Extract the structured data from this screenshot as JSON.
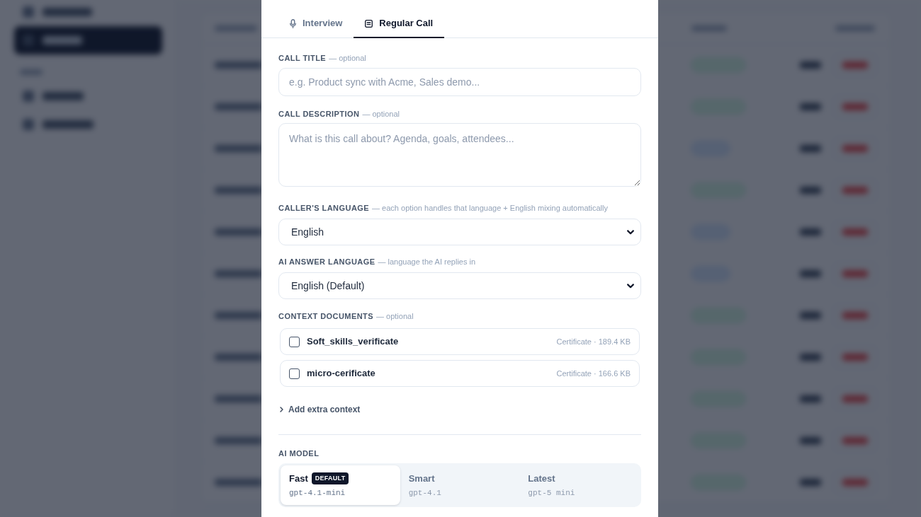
{
  "tabs": [
    {
      "label": "Interview",
      "selected": false
    },
    {
      "label": "Regular Call",
      "selected": true
    }
  ],
  "call_title": {
    "label": "CALL TITLE",
    "hint": "— optional",
    "placeholder": "e.g. Product sync with Acme, Sales demo..."
  },
  "call_description": {
    "label": "CALL DESCRIPTION",
    "hint": "— optional",
    "placeholder": "What is this call about? Agenda, goals, attendees..."
  },
  "callers_language": {
    "label": "CALLER'S LANGUAGE",
    "hint": "— each option handles that language + English mixing automatically",
    "value": "English"
  },
  "ai_answer_language": {
    "label": "AI ANSWER LANGUAGE",
    "hint": "— language the AI replies in",
    "value": "English (Default)"
  },
  "context_documents": {
    "label": "CONTEXT DOCUMENTS",
    "hint": "— optional",
    "items": [
      {
        "name": "Soft_skills_verificate",
        "meta": "Certificate · 189.4 KB",
        "checked": false
      },
      {
        "name": "micro-cerificate",
        "meta": "Certificate · 166.6 KB",
        "checked": false
      }
    ]
  },
  "extra_context": {
    "label": "Add extra context",
    "expanded": false
  },
  "ai_model": {
    "label": "AI MODEL",
    "options": [
      {
        "name": "Fast",
        "badge": "DEFAULT",
        "model": "gpt-4.1-mini",
        "selected": true
      },
      {
        "name": "Smart",
        "model": "gpt-4.1",
        "selected": false
      },
      {
        "name": "Latest",
        "model": "gpt-5 mini",
        "selected": false
      }
    ]
  }
}
